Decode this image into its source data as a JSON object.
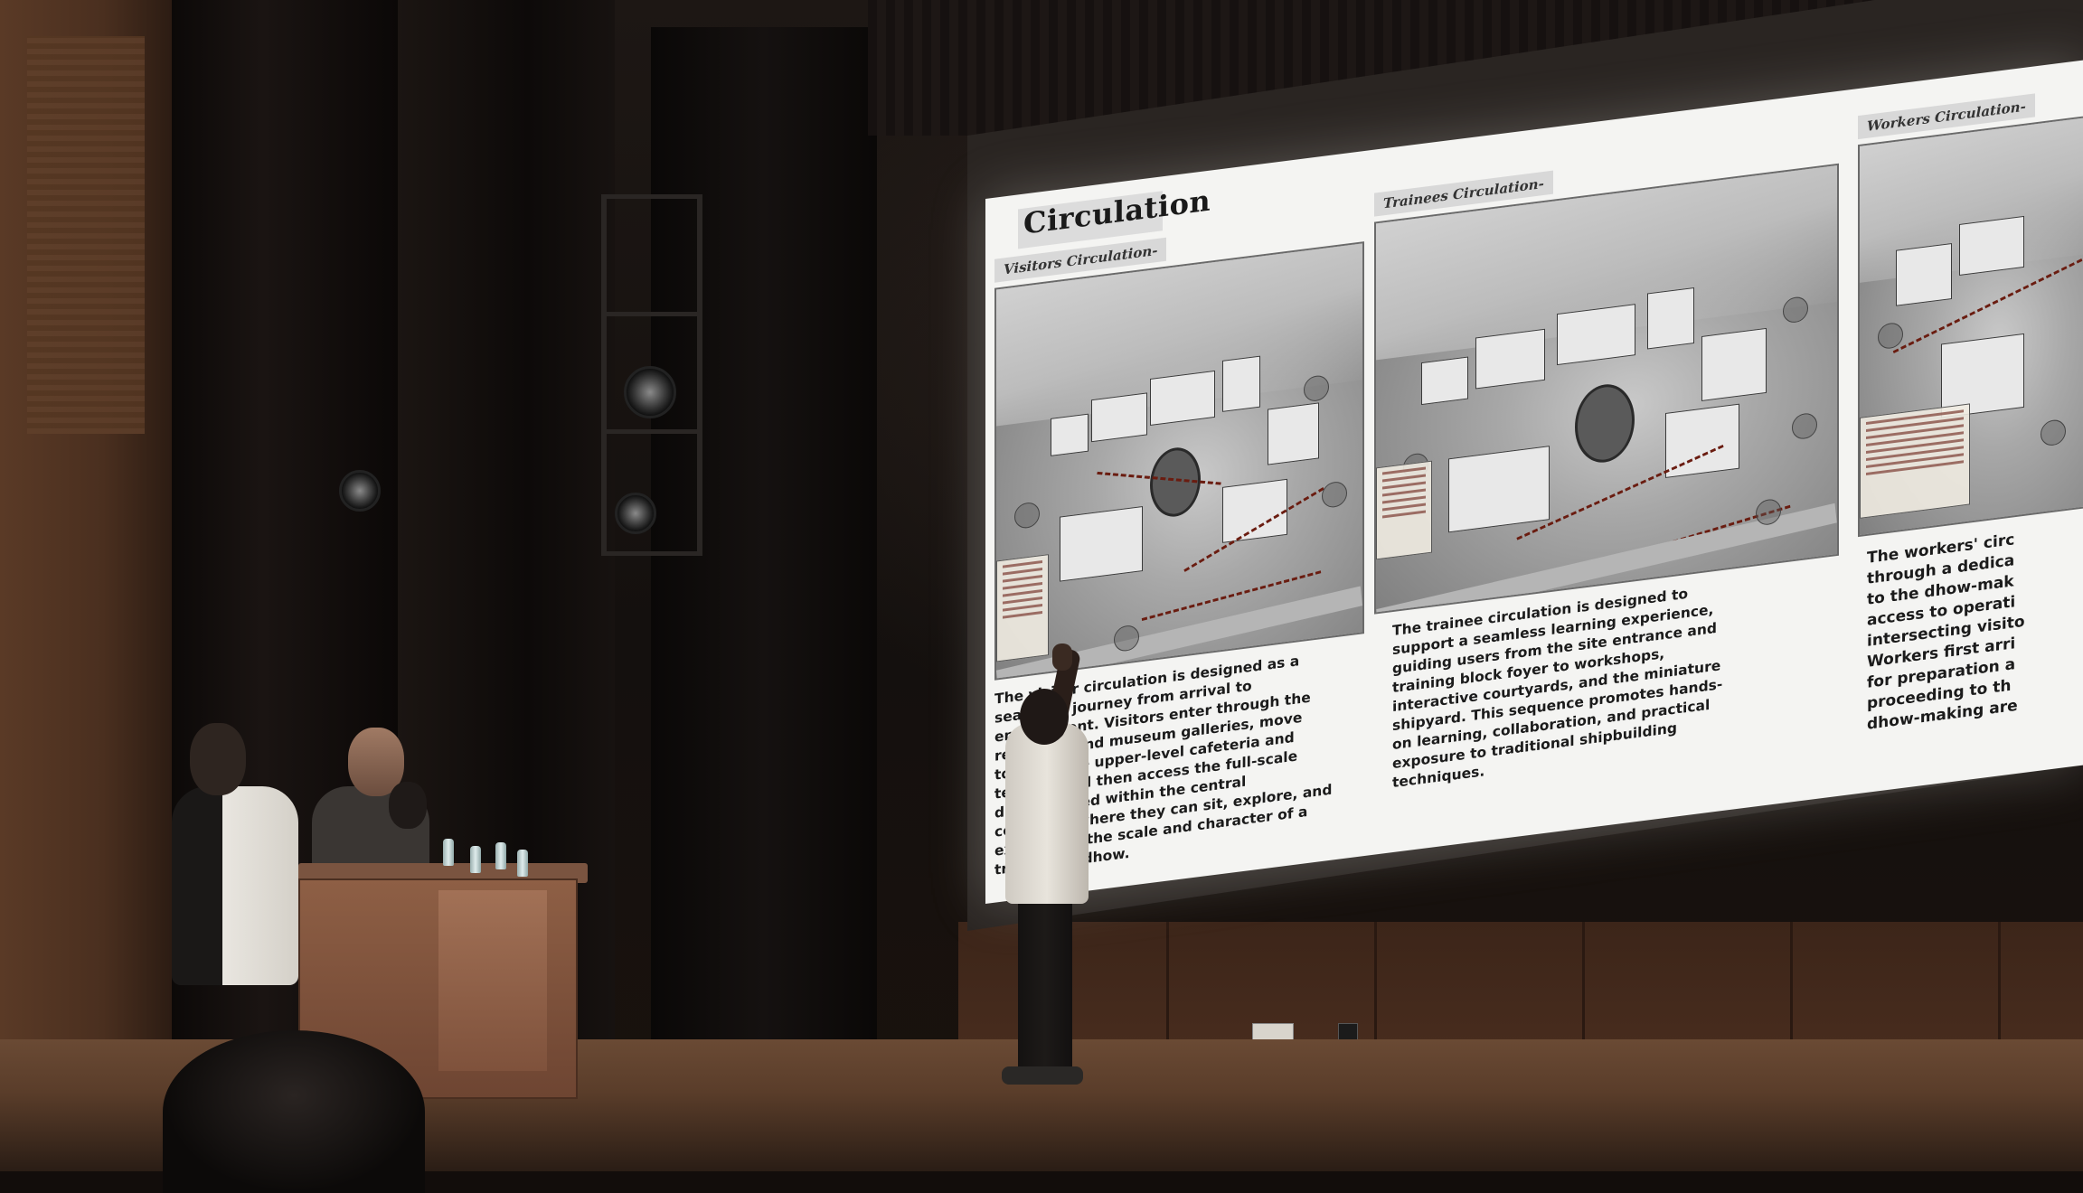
{
  "slide": {
    "title": "Circulation",
    "panels": [
      {
        "label": "Visitors Circulation-",
        "text": "The visitor circulation is designed as a\nseamless journey from arrival to\nengagement. Visitors enter through the\nreception and museum galleries, move\ntowards the upper-level cafeteria and\nterrace, and then access the full-scale\ndhow located within the central\ncourtyard where they can sit, explore, and\nexperience the scale and character of a\ntraditional dhow."
      },
      {
        "label": "Trainees Circulation-",
        "text": "The trainee circulation is designed to\nsupport a seamless learning experience,\nguiding users from the site entrance and\ntraining block foyer to workshops,\ninteractive courtyards, and the miniature\nshipyard. This sequence promotes hands-\non learning, collaboration, and practical\nexposure to traditional shipbuilding\ntechniques."
      },
      {
        "label": "Workers Circulation-",
        "text": "The workers' circ\nthrough a dedica\nto the dhow-mak\naccess to operati\nintersecting visito\nWorkers first arri\nfor preparation a\nproceeding to th\ndhow-making are"
      }
    ]
  },
  "colors": {
    "screen": "#f4f4f2",
    "path_marker": "#6a1c10",
    "stage_wall": "#4b2e1f",
    "floor": "#6a4a34"
  }
}
